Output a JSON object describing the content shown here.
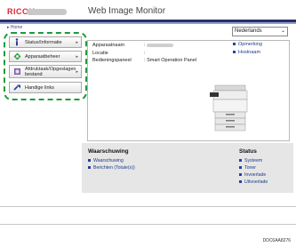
{
  "header": {
    "logo": "RICOH",
    "title": "Web Image Monitor",
    "home": "▸ Home",
    "language": "Nederlands"
  },
  "nav": {
    "items": [
      {
        "label": "Status/Informatie",
        "icon": "info-icon"
      },
      {
        "label": "Apparaatbeheer",
        "icon": "device-management-icon"
      },
      {
        "label": "Afdruktaak/Opgeslagen bestand",
        "icon": "print-job-icon"
      },
      {
        "label": "Handige links",
        "icon": "link-icon"
      }
    ]
  },
  "device": {
    "rows": [
      {
        "label": "Apparaatnaam",
        "sep": ":",
        "value": ""
      },
      {
        "label": "Locatie",
        "sep": ":",
        "value": ""
      },
      {
        "label": "Bedieningspaneel",
        "sep": ":",
        "value": "Smart Operation Panel"
      }
    ],
    "links": [
      "Opmerking",
      "Hostnaam"
    ]
  },
  "bottom": {
    "warning_title": "Waarschuwing",
    "warning_links": [
      "Waarschuwing",
      "Berichten (Totale(s))"
    ],
    "status_title": "Status",
    "status_links": [
      "Systeem",
      "Toner",
      "Invoerlade",
      "Uitvoerlade"
    ]
  },
  "footer": {
    "code": "DDC6AA8276"
  },
  "colors": {
    "accent": "#2b2e6e",
    "highlight": "#1f9a3a",
    "brand": "#d7282f"
  }
}
